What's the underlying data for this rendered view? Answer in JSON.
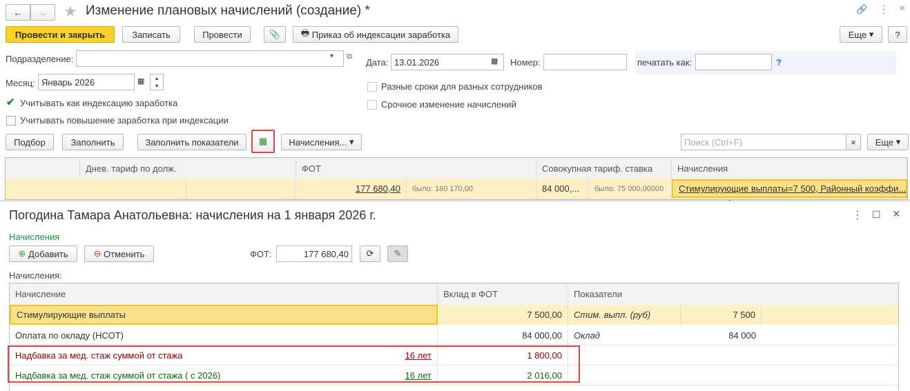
{
  "window": {
    "title": "Изменение плановых начислений (создание) *"
  },
  "toolbar": {
    "post_close": "Провести и закрыть",
    "save": "Записать",
    "post": "Провести",
    "print_order": "Приказ об индексации заработка",
    "more": "Еще",
    "help": "?"
  },
  "form": {
    "division_label": "Подразделение:",
    "division_value": "",
    "date_label": "Дата:",
    "date_value": "13.01.2026",
    "number_label": "Номер:",
    "number_value": "",
    "print_as_label": "печатать как:",
    "print_as_value": "",
    "print_help": "?",
    "month_label": "Месяц:",
    "month_value": "Январь 2026",
    "chk_indexation": "Учитывать как индексацию заработка",
    "chk_indexation_checked": true,
    "chk_raise": "Учитывать повышение заработка при индексации",
    "chk_raise_checked": false,
    "chk_diff_terms": "Разные сроки для разных сотрудников",
    "chk_diff_terms_checked": false,
    "chk_urgent": "Срочное изменение начислений",
    "chk_urgent_checked": false
  },
  "table_toolbar": {
    "pick": "Подбор",
    "fill": "Заполнить",
    "fill_indicators": "Заполнить показатели",
    "accruals": "Начисления...",
    "search_placeholder": "Поиск (Ctrl+F)",
    "clear": "×",
    "more": "Еще"
  },
  "main_table": {
    "headers": [
      "",
      "Днев. тариф по долж.",
      "ФОТ",
      "Совокупная тариф. ставка",
      "Начисления"
    ],
    "row": {
      "fot": "177 680,40",
      "fot_was": "было: 160 170,00",
      "rate": "84 000,...",
      "rate_was": "было: 75 000,00000",
      "accruals": "Стимулирующие выплаты=7 500, Районный коэффи..."
    }
  },
  "dialog": {
    "title": "Погодина Тамара Анатольевна: начисления на 1 января 2026 г.",
    "section": "Начисления",
    "add": "Добавить",
    "cancel": "Отменить",
    "fot_label": "ФОТ:",
    "fot_value": "177 680,40",
    "list_label": "Начисления:",
    "headers": [
      "Начисление",
      "Вклад в ФОТ",
      "Показатели"
    ],
    "rows": [
      {
        "name": "Стимулирующие выплаты",
        "link": "",
        "amount": "7 500,00",
        "indicator": "Стим. выпл. (руб)",
        "ind_value": "7 500"
      },
      {
        "name": "Оплата по окладу (НСОТ)",
        "link": "",
        "amount": "84 000,00",
        "indicator": "Оклад",
        "ind_value": "84 000"
      },
      {
        "name": "Надбавка за мед. стаж суммой от стажа",
        "link": "16 лет",
        "amount": "1 800,00",
        "indicator": "",
        "ind_value": ""
      },
      {
        "name": "Надбавка за мед. стаж суммой от стажа ( с 2026)",
        "link": "16 лет",
        "amount": "2 016,00",
        "indicator": "",
        "ind_value": ""
      }
    ]
  },
  "colors": {
    "accent": "#f5d743",
    "highlight": "#fdf1c3",
    "red": "#e8413f",
    "dark_red": "#8b0000",
    "green": "#0a6b0a"
  }
}
